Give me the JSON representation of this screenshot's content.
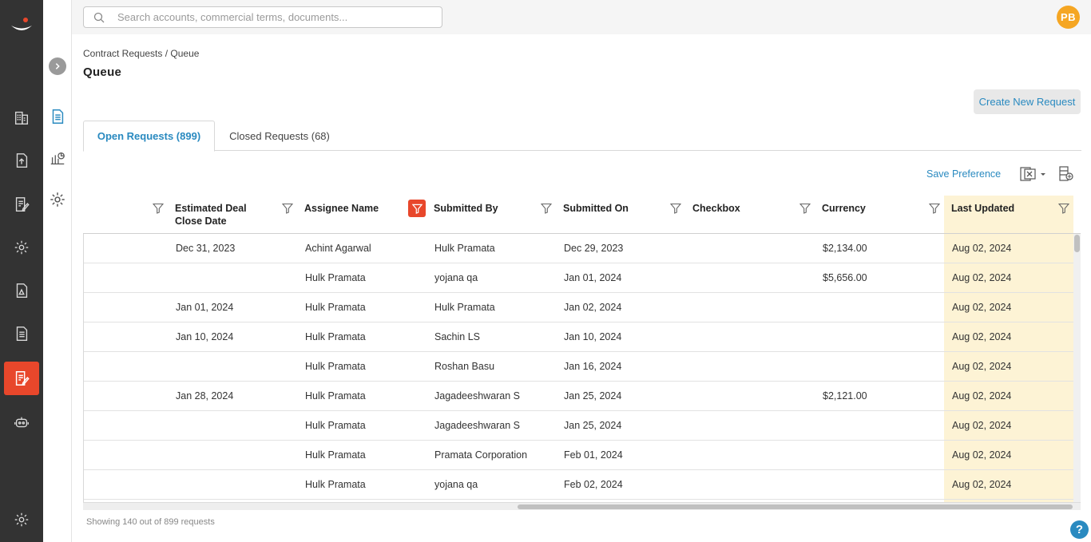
{
  "search": {
    "placeholder": "Search accounts, commercial terms, documents..."
  },
  "user": {
    "initials": "PB"
  },
  "breadcrumb": "Contract Requests / Queue",
  "page_title": "Queue",
  "actions": {
    "create_new_request": "Create New Request",
    "save_preference": "Save Preference"
  },
  "tabs": [
    {
      "label": "Open Requests (899)",
      "active": true
    },
    {
      "label": "Closed Requests (68)",
      "active": false
    }
  ],
  "columns": [
    {
      "label": "Estimated Deal Close Date"
    },
    {
      "label": "Assignee Name"
    },
    {
      "label": "Submitted By",
      "filter_active": true
    },
    {
      "label": "Submitted On"
    },
    {
      "label": "Checkbox"
    },
    {
      "label": "Currency"
    },
    {
      "label": "Last Updated"
    }
  ],
  "rows": [
    {
      "close_date": "Dec 31, 2023",
      "assignee": "Achint Agarwal",
      "submitted_by": "Hulk Pramata",
      "submitted_on": "Dec 29, 2023",
      "checkbox": "",
      "currency": "$2,134.00",
      "last_updated": "Aug 02, 2024"
    },
    {
      "close_date": "",
      "assignee": "Hulk Pramata",
      "submitted_by": "yojana qa",
      "submitted_on": "Jan 01, 2024",
      "checkbox": "",
      "currency": "$5,656.00",
      "last_updated": "Aug 02, 2024"
    },
    {
      "close_date": "Jan 01, 2024",
      "assignee": "Hulk Pramata",
      "submitted_by": "Hulk Pramata",
      "submitted_on": "Jan 02, 2024",
      "checkbox": "",
      "currency": "",
      "last_updated": "Aug 02, 2024"
    },
    {
      "close_date": "Jan 10, 2024",
      "assignee": "Hulk Pramata",
      "submitted_by": "Sachin LS",
      "submitted_on": "Jan 10, 2024",
      "checkbox": "",
      "currency": "",
      "last_updated": "Aug 02, 2024"
    },
    {
      "close_date": "",
      "assignee": "Hulk Pramata",
      "submitted_by": "Roshan Basu",
      "submitted_on": "Jan 16, 2024",
      "checkbox": "",
      "currency": "",
      "last_updated": "Aug 02, 2024"
    },
    {
      "close_date": "Jan 28, 2024",
      "assignee": "Hulk Pramata",
      "submitted_by": "Jagadeeshwaran S",
      "submitted_on": "Jan 25, 2024",
      "checkbox": "",
      "currency": "$2,121.00",
      "last_updated": "Aug 02, 2024"
    },
    {
      "close_date": "",
      "assignee": "Hulk Pramata",
      "submitted_by": "Jagadeeshwaran S",
      "submitted_on": "Jan 25, 2024",
      "checkbox": "",
      "currency": "",
      "last_updated": "Aug 02, 2024"
    },
    {
      "close_date": "",
      "assignee": "Hulk Pramata",
      "submitted_by": "Pramata Corporation",
      "submitted_on": "Feb 01, 2024",
      "checkbox": "",
      "currency": "",
      "last_updated": "Aug 02, 2024"
    },
    {
      "close_date": "",
      "assignee": "Hulk Pramata",
      "submitted_by": "yojana qa",
      "submitted_on": "Feb 02, 2024",
      "checkbox": "",
      "currency": "",
      "last_updated": "Aug 02, 2024"
    }
  ],
  "footer": {
    "count_text": "Showing 140 out of 899 requests"
  },
  "help": {
    "label": "?"
  },
  "colors": {
    "accent": "#e8472b",
    "link": "#2a8ac0",
    "highlight_column": "#fdf3d5",
    "rail": "#333333"
  }
}
